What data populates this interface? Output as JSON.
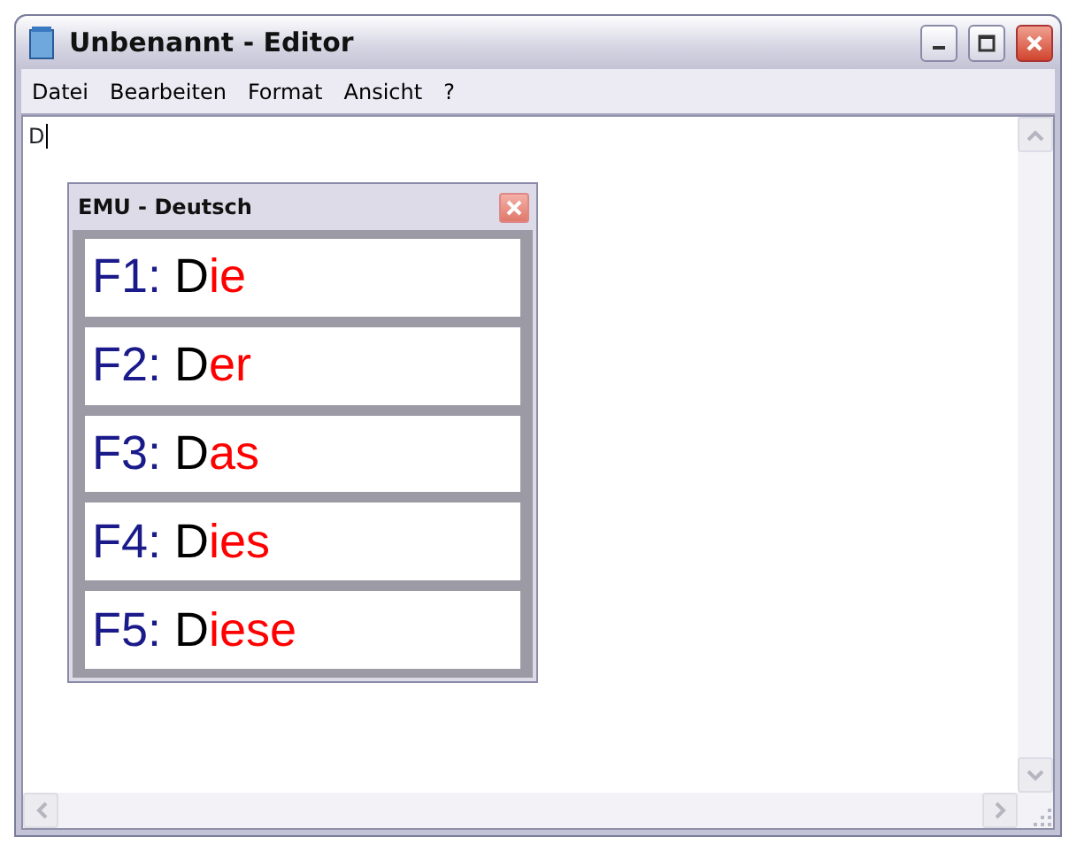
{
  "window": {
    "title": "Unbenannt - Editor"
  },
  "menu": [
    "Datei",
    "Bearbeiten",
    "Format",
    "Ansicht",
    "?"
  ],
  "editor": {
    "text": "D"
  },
  "popup": {
    "title": "EMU - Deutsch",
    "suggestions": [
      {
        "key": "F1:",
        "typed": "D",
        "completion": "ie"
      },
      {
        "key": "F2:",
        "typed": "D",
        "completion": "er"
      },
      {
        "key": "F3:",
        "typed": "D",
        "completion": "as"
      },
      {
        "key": "F4:",
        "typed": "D",
        "completion": "ies"
      },
      {
        "key": "F5:",
        "typed": "D",
        "completion": "iese"
      }
    ]
  }
}
